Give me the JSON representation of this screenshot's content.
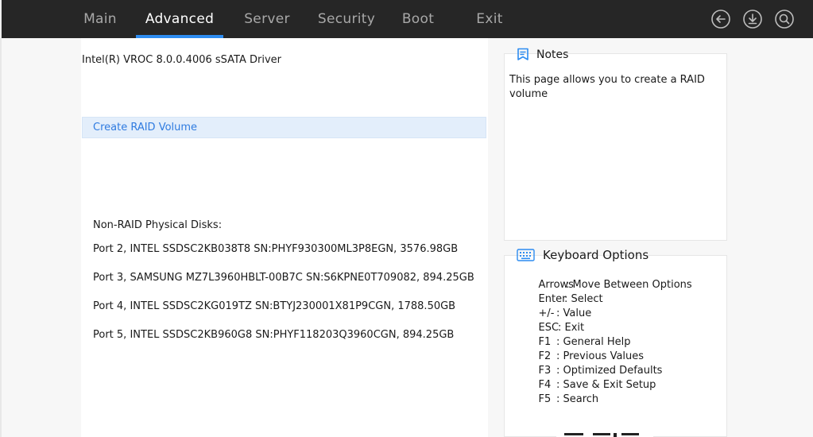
{
  "nav": {
    "tabs": [
      {
        "label": "Main"
      },
      {
        "label": "Advanced"
      },
      {
        "label": "Server"
      },
      {
        "label": "Security"
      },
      {
        "label": "Boot"
      },
      {
        "label": "Exit"
      }
    ],
    "active_tab": "Advanced",
    "icons": [
      "back-icon",
      "download-icon",
      "search-icon"
    ]
  },
  "main": {
    "driver_title": "Intel(R) VROC 8.0.0.4006 sSATA Driver",
    "create_raid_label": "Create RAID Volume",
    "disks_heading": "Non-RAID Physical Disks:",
    "disks": [
      "Port 2, INTEL SSDSC2KB038T8 SN:PHYF930300ML3P8EGN, 3576.98GB",
      "Port 3, SAMSUNG MZ7L3960HBLT-00B7C SN:S6KPNE0T709082, 894.25GB",
      "Port 4, INTEL SSDSC2KG019TZ SN:BTYJ230001X81P9CGN, 1788.50GB",
      "Port 5, INTEL SSDSC2KB960G8 SN:PHYF118203Q3960CGN, 894.25GB"
    ]
  },
  "notes": {
    "title": "Notes",
    "text": "This page allows you to create a RAID volume"
  },
  "keyboard": {
    "title": "Keyboard Options",
    "options": [
      {
        "key": "Arrows",
        "desc": ": Move Between Options"
      },
      {
        "key": "Enter",
        "desc": ": Select"
      },
      {
        "key": "+/-",
        "desc": ": Value"
      },
      {
        "key": "ESC",
        "desc": ": Exit"
      },
      {
        "key": "F1",
        "desc": ": General Help"
      },
      {
        "key": "F2",
        "desc": ": Previous Values"
      },
      {
        "key": "F3",
        "desc": ": Optimized Defaults"
      },
      {
        "key": "F4",
        "desc": ": Save & Exit Setup"
      },
      {
        "key": "F5",
        "desc": ": Search"
      }
    ]
  },
  "colors": {
    "topbar": "#262626",
    "accent": "#2d8cf0",
    "selected_row": "#e3eefb",
    "link_text": "#2f7be0"
  }
}
